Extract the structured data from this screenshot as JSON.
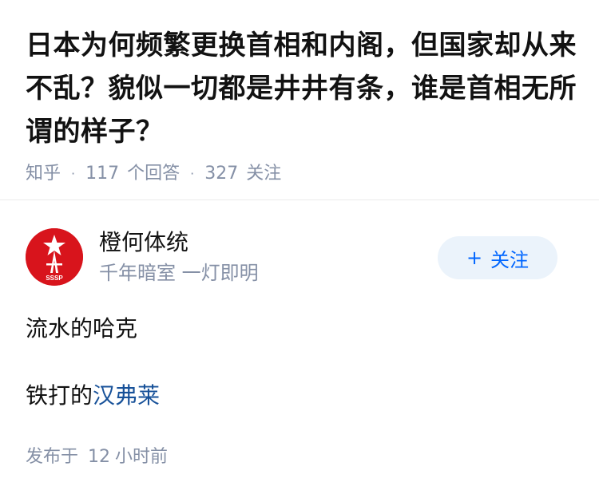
{
  "question": {
    "title": "日本为何频繁更换首相和内阁，但国家却从来不乱？貌似一切都是井井有条，谁是首相无所谓的样子？",
    "source": "知乎",
    "answer_count": "117",
    "answer_label": "个回答",
    "follower_count": "327",
    "follower_label": "关注"
  },
  "author": {
    "name": "橙何体统",
    "bio": "千年暗室 一灯即明",
    "avatar_text": "SSSP",
    "follow_label": "关注",
    "avatar_color": "#d8141c"
  },
  "answer": {
    "line1": "流水的哈克",
    "line2_prefix": "铁打的",
    "line2_link": "汉弗莱"
  },
  "publish": {
    "prefix": "发布于",
    "number": "12",
    "suffix": "小时前"
  },
  "colors": {
    "accent": "#0066ff",
    "link": "#175199",
    "meta": "#8590a6",
    "follow_bg": "#ebf3fb"
  }
}
